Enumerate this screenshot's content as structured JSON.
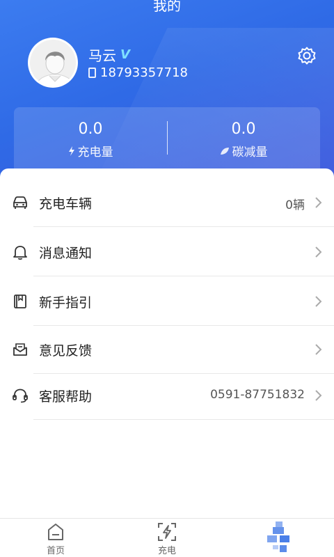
{
  "header": {
    "title": "我的",
    "user_name": "马云",
    "verified_icon": "verified-v-icon",
    "phone": "18793357718",
    "settings_icon": "gear-icon"
  },
  "stats": {
    "charge": {
      "value": "0.0",
      "label": "充电量",
      "icon": "lightning-icon"
    },
    "carbon": {
      "value": "0.0",
      "label": "碳减量",
      "icon": "leaf-icon"
    }
  },
  "menu": {
    "items": [
      {
        "label": "充电车辆",
        "value": "0辆",
        "icon": "car-icon"
      },
      {
        "label": "消息通知",
        "value": "",
        "icon": "bell-icon"
      },
      {
        "label": "新手指引",
        "value": "",
        "icon": "book-icon"
      },
      {
        "label": "意见反馈",
        "value": "",
        "icon": "envelope-icon"
      },
      {
        "label": "客服帮助",
        "value": "0591-87751832",
        "icon": "headset-icon"
      }
    ]
  },
  "tabbar": {
    "tabs": [
      {
        "label": "首页",
        "icon": "home-icon"
      },
      {
        "label": "充电",
        "icon": "charge-scan-icon"
      },
      {
        "label": "",
        "icon": "profile-pixelated-icon"
      }
    ]
  },
  "colors": {
    "header_gradient_start": "#3c7cf0",
    "header_gradient_end": "#3a56dc",
    "accent": "#4a7fe8"
  }
}
